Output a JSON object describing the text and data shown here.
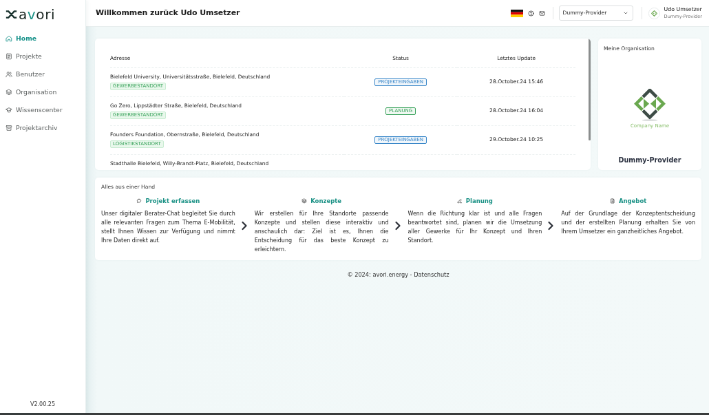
{
  "sidebar": {
    "logo": "avori",
    "items": [
      {
        "label": "Home",
        "selected": true
      },
      {
        "label": "Projekte",
        "selected": false
      },
      {
        "label": "Benutzer",
        "selected": false
      },
      {
        "label": "Organisation",
        "selected": false
      },
      {
        "label": "Wissenscenter",
        "selected": false
      },
      {
        "label": "Projektarchiv",
        "selected": false
      }
    ],
    "version": "V2.00.25"
  },
  "header": {
    "title": "Willkommen zurück Udo Umsetzer",
    "provider_select": "Dummy-Provider",
    "user": {
      "name": "Udo Umsetzer",
      "organization": "Dummy-Provider"
    }
  },
  "projects_table": {
    "columns": [
      "Adresse",
      "Status",
      "Letztes Update"
    ],
    "rows": [
      {
        "address": "Bielefeld University, Universitätsstraße, Bielefeld, Deutschland",
        "category": "GEWERBESTANDORT",
        "status": {
          "label": "PROJEKTEINGABEN",
          "color": "#3a87c9"
        },
        "updated": "28.October.24 15:46"
      },
      {
        "address": "Go Zero, Lippstädter Straße, Bielefeld, Deutschland",
        "category": "GEWERBESTANDORT",
        "status": {
          "label": "PLANUNG",
          "color": "#3aa35c"
        },
        "updated": "28.October.24 16:04"
      },
      {
        "address": "Founders Foundation, Obernstraße, Bielefeld, Deutschland",
        "category": "LOGISTIKSTANDORT",
        "status": {
          "label": "PROJEKTEINGABEN",
          "color": "#3a87c9"
        },
        "updated": "29.October.24 10:25"
      },
      {
        "address": "Stadthalle Bielefeld, Willy-Brandt-Platz, Bielefeld, Deutschland"
      }
    ]
  },
  "organization_card": {
    "title": "Meine Organisation",
    "logo_caption": "Company Name",
    "name": "Dummy-Provider"
  },
  "steps_card": {
    "title": "Alles aus einer Hand",
    "steps": [
      {
        "title": "Projekt erfassen",
        "text": "Unser digitaler Berater-Chat begleitet Sie durch alle relevanten Fragen zum Thema E-Mobilität, stellt Ihnen Wissen zur Verfügung und nimmt Ihre Daten direkt auf."
      },
      {
        "title": "Konzepte",
        "text": "Wir erstellen für Ihre Standorte passende Konzepte und stellen diese interaktiv und anschaulich dar: Ziel ist es, Ihnen die Entscheidung für das beste Konzept zu erleichtern."
      },
      {
        "title": "Planung",
        "text": "Wenn die Richtung klar ist und alle Fragen beantwortet sind, planen wir die Umsetzung aller Gewerke für Ihr Konzept und Ihren Standort."
      },
      {
        "title": "Angebot",
        "text": "Auf der Grundlage der Konzeptentscheidung und der erstellten Planung erhalten Sie von Ihrem Umsetzer ein ganzheitliches Angebot."
      }
    ]
  },
  "footer": {
    "copyright": "© 2024: avori.energy -",
    "privacy_link": "Datenschutz"
  }
}
